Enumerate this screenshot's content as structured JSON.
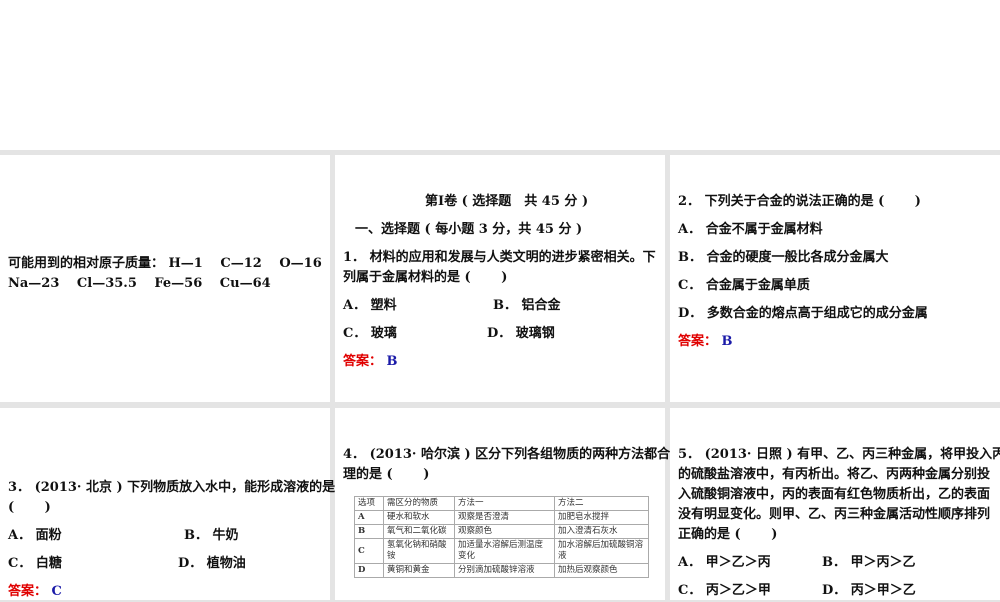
{
  "slide1": {
    "line1": "可能用到的相对原子质量： H—1　 C—12　 O—16",
    "line2": "Na—23　 Cl—35.5　 Fe—56　 Cu—64"
  },
  "slide2": {
    "title": "第Ⅰ卷 ( 选择题　共 45 分 )",
    "section": "一、选择题 ( 每小题 3 分，共 45 分 )",
    "q1": "1． 材料的应用和发展与人类文明的进步紧密相关。下",
    "q2": "列属于金属材料的是 (　　 )",
    "a": "A． 塑料",
    "b": "B． 铝合金",
    "c": "C． 玻璃",
    "d": "D． 玻璃钢",
    "answer_label": "答案：",
    "answer": "B"
  },
  "slide3": {
    "q": "2． 下列关于合金的说法正确的是 (　　 )",
    "a": "A． 合金不属于金属材料",
    "b": "B． 合金的硬度一般比各成分金属大",
    "c": "C． 合金属于金属单质",
    "d": "D． 多数合金的熔点高于组成它的成分金属",
    "answer_label": "答案：",
    "answer": "B"
  },
  "slide4": {
    "q1": "3． (2013· 北京 ) 下列物质放入水中，能形成溶液的是",
    "q2": "(　　 )",
    "a": "A． 面粉",
    "b": "B． 牛奶",
    "c": "C． 白糖",
    "d": "D． 植物油",
    "answer_label": "答案：",
    "answer": "C"
  },
  "slide5": {
    "q1": "4． (2013· 哈尔滨 ) 区分下列各组物质的两种方法都合",
    "q2": "理的是 (　　 )",
    "table": {
      "headers": [
        "选项",
        "需区分的物质",
        "方法一",
        "方法二"
      ],
      "rows": [
        [
          "A",
          "硬水和软水",
          "观察是否澄清",
          "加肥皂水搅拌"
        ],
        [
          "B",
          "氧气和二氧化碳",
          "观察颜色",
          "加入澄清石灰水"
        ],
        [
          "C",
          "氢氧化钠和硝酸铵",
          "加适量水溶解后测温度变化",
          "加水溶解后加硫酸铜溶液"
        ],
        [
          "D",
          "黄铜和黄金",
          "分别滴加硫酸锌溶液",
          "加热后观察颜色"
        ]
      ]
    }
  },
  "slide6": {
    "lines": [
      "5． (2013· 日照 ) 有甲、乙、丙三种金属，将甲投入丙",
      "的硫酸盐溶液中，有丙析出。将乙、丙两种金属分别投",
      "入硫酸铜溶液中，丙的表面有红色物质析出，乙的表面",
      "没有明显变化。则甲、乙、丙三种金属活动性顺序排列",
      "正确的是 (　　 )"
    ],
    "a": "A． 甲＞乙＞丙",
    "b": "B． 甲＞丙＞乙",
    "c": "C． 丙＞乙＞甲",
    "d": "D． 丙＞甲＞乙"
  }
}
